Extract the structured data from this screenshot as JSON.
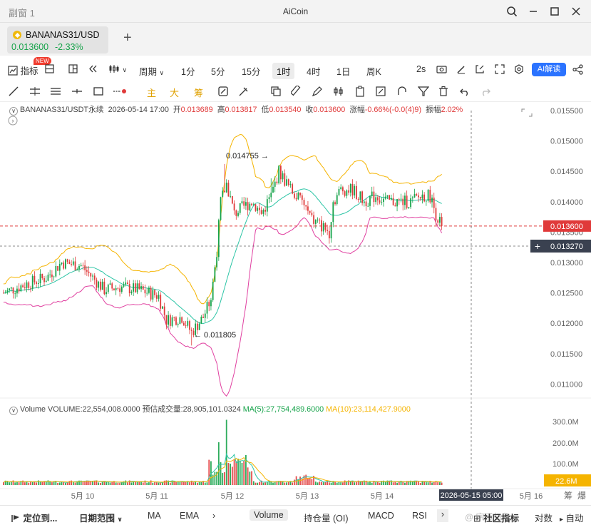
{
  "window": {
    "title_left": "副窗 1",
    "title": "AiCoin"
  },
  "tab": {
    "symbol": "BANANAS31/USD",
    "price": "0.013600",
    "change": "-2.33%",
    "new_badge": "NEW"
  },
  "toolbar": {
    "indicator": "指标",
    "period": "周期",
    "timeframes": [
      "1分",
      "5分",
      "15分",
      "1时",
      "4时",
      "1日",
      "周K"
    ],
    "active_timeframe": "1时",
    "refresh": "2s",
    "ai": "AI解读"
  },
  "draw_tools": {
    "zhu": "主",
    "da": "大",
    "chou": "筹"
  },
  "info": {
    "symbol": "BANANAS31/USDT永续",
    "time": "2026-05-14 17:00",
    "open_l": "开",
    "open": "0.013689",
    "high_l": "高",
    "high": "0.013817",
    "low_l": "低",
    "low": "0.013540",
    "close_l": "收",
    "close": "0.013600",
    "chg_l": "涨幅",
    "chg": "-0.66%(-0.0(4)9)",
    "amp_l": "振幅",
    "amp": "2.02%"
  },
  "volume_info": {
    "label": "Volume",
    "volume": "VOLUME:22,554,008.0000",
    "est": "预估成交量:28,905,101.0324",
    "ma5": "MA(5):27,754,489.6000",
    "ma10": "MA(10):23,114,427.9000"
  },
  "chart": {
    "price_axis": [
      "0.015500",
      "0.015000",
      "0.014500",
      "0.014000",
      "0.013500",
      "0.013000",
      "0.012500",
      "0.012000",
      "0.011500",
      "0.011000"
    ],
    "current_price": "0.013600",
    "crosshair_price": "0.013270",
    "high_annotation": "0.014755",
    "low_annotation": "0.011805",
    "volume_axis": [
      "300.0M",
      "200.0M",
      "100.0M"
    ],
    "current_volume": "22.6M",
    "date_axis": [
      "5月 10",
      "5月 11",
      "5月 12",
      "5月 13",
      "5月 14",
      "5月 16"
    ],
    "crosshair_time": "2026-05-15 05:00",
    "corner_labels": [
      "筹",
      "爆"
    ]
  },
  "bottom": {
    "locate": "定位到...",
    "range": "日期范围",
    "items": [
      "MA",
      "EMA",
      "Volume",
      "持仓量 (OI)",
      "MACD",
      "RSI"
    ],
    "active": "Volume",
    "community": "社区指标",
    "compare": "对数",
    "auto": "自动",
    "watermark": "@ 宗币归段"
  },
  "colors": {
    "up": "#16a34a",
    "down": "#e03a3a",
    "boll_upper": "#f5b400",
    "boll_mid": "#2dc5a6",
    "boll_lower": "#e040a0",
    "ma10": "#f5b400"
  }
}
